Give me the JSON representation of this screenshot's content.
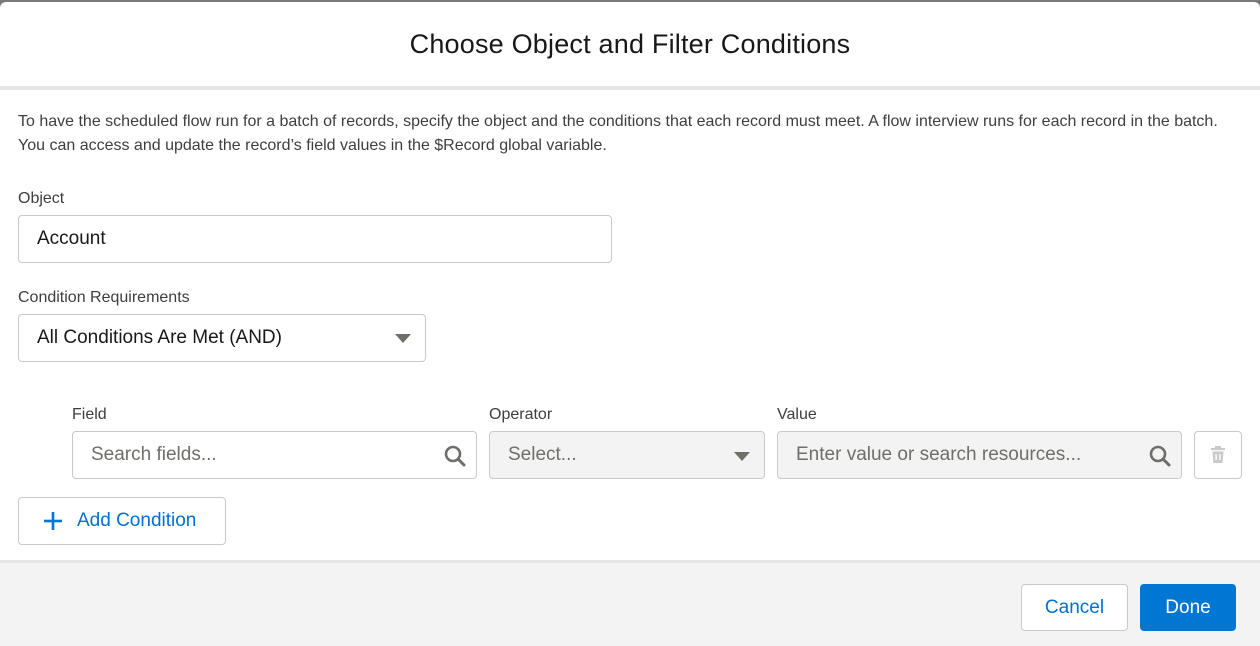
{
  "modal": {
    "title": "Choose Object and Filter Conditions",
    "description": "To have the scheduled flow run for a batch of records, specify the object and the conditions that each record must meet. A flow interview runs for each record in the batch. You can access and update the record’s field values in the $Record global variable."
  },
  "object": {
    "label": "Object",
    "value": "Account"
  },
  "condition_requirements": {
    "label": "Condition Requirements",
    "selected": "All Conditions Are Met (AND)"
  },
  "condition_row": {
    "field_label": "Field",
    "field_placeholder": "Search fields...",
    "operator_label": "Operator",
    "operator_placeholder": "Select...",
    "value_label": "Value",
    "value_placeholder": "Enter value or search resources..."
  },
  "add_condition": {
    "icon": "plus-icon",
    "label": "Add Condition"
  },
  "footer": {
    "cancel_label": "Cancel",
    "done_label": "Done"
  },
  "colors": {
    "brand": "#0176d3",
    "link": "#0070d2"
  }
}
